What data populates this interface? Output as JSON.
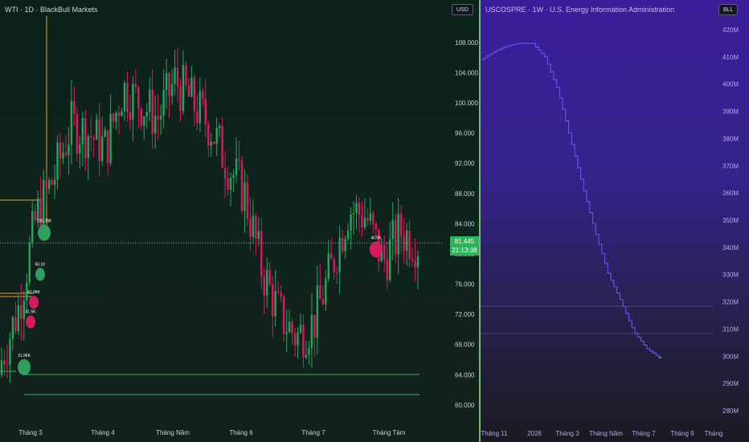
{
  "left_chart": {
    "title": "WTI · 1D · BlackBull Markets",
    "currency": "USD",
    "last_price": "81.445",
    "countdown": "21:13:38",
    "y_axis": {
      "labels": [
        "108.000",
        "104.000",
        "100.000",
        "96.000",
        "92.000",
        "88.000",
        "84.000",
        "80.000",
        "76.000",
        "72.000",
        "68.000",
        "64.000",
        "60.000"
      ],
      "range": [
        58.5,
        111.5
      ]
    },
    "x_axis": {
      "labels": [
        "Tháng 3",
        "Tháng 4",
        "Tháng Năm",
        "Tháng 6",
        "Tháng 7",
        "Tháng Tám"
      ]
    },
    "markers": [
      {
        "label": "21.96K",
        "color": "green",
        "price": 65.0
      },
      {
        "label": "31.5K",
        "color": "red",
        "price": 71.0
      },
      {
        "label": "41.98K",
        "color": "red",
        "price": 73.6
      },
      {
        "label": "56.1K",
        "color": "green",
        "price": 77.3
      },
      {
        "label": "105.78K",
        "color": "green",
        "price": 82.8
      },
      {
        "label": "40.5K",
        "color": "red",
        "price": 80.6
      }
    ],
    "colors": {
      "up": "#26a65b",
      "down": "#d81b60",
      "level_line": "#3fae63",
      "orange_line": "#e8a23d"
    }
  },
  "right_chart": {
    "title": "USCOSPRE · 1W · U.S. Energy Information Administration",
    "unit": "BLL",
    "y_axis": {
      "labels": [
        "420M",
        "410M",
        "400M",
        "390M",
        "380M",
        "370M",
        "360M",
        "350M",
        "340M",
        "330M",
        "320M",
        "310M",
        "300M",
        "290M",
        "280M"
      ],
      "range": [
        275,
        425
      ]
    },
    "x_axis": {
      "labels": [
        "Tháng 11",
        "2026",
        "Tháng 3",
        "Tháng Năm",
        "Tháng 7",
        "Tháng 9",
        "Tháng"
      ]
    },
    "colors": {
      "line": "#5f52e8",
      "end": "#39d38a"
    }
  },
  "chart_data": [
    {
      "type": "line",
      "title": "WTI · 1D · BlackBull Markets",
      "x": [
        "Tháng 3",
        "Tháng 4",
        "Tháng Năm",
        "Tháng 6",
        "Tháng 7",
        "Tháng Tám"
      ],
      "series": [
        {
          "name": "WTI",
          "values": [
            66,
            73,
            85,
            90,
            97,
            96,
            94,
            102,
            100,
            98,
            103,
            100,
            97,
            92,
            88,
            78,
            72,
            69,
            71,
            78,
            86,
            85,
            79,
            83,
            81.445
          ]
        }
      ],
      "ylim": [
        58.5,
        111.5
      ]
    },
    {
      "type": "line",
      "title": "USCOSPRE · 1W · U.S. Energy Information Administration",
      "x": [
        "Tháng 11",
        "2026",
        "Tháng 3",
        "Tháng Năm",
        "Tháng 7",
        "Tháng 9"
      ],
      "series": [
        {
          "name": "USCOSPRE",
          "values": [
            409,
            412,
            414,
            415,
            415,
            410,
            398,
            380,
            362,
            345,
            330,
            320,
            309,
            303,
            299.5
          ]
        }
      ],
      "ylim": [
        275,
        425
      ]
    }
  ]
}
